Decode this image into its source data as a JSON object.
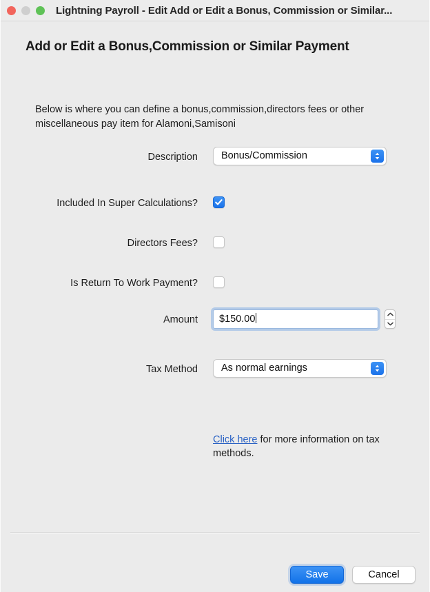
{
  "window": {
    "title": "Lightning Payroll - Edit Add or Edit a Bonus, Commission or Similar...",
    "traffic_lights": {
      "close": "close-button",
      "minimize": "minimize-button",
      "zoom": "zoom-button"
    }
  },
  "page": {
    "heading": "Add or Edit a Bonus,Commission or Similar Payment",
    "intro": "Below is where you can define a bonus,commission,directors fees or other miscellaneous pay item for Alamoni,Samisoni"
  },
  "form": {
    "description": {
      "label": "Description",
      "value": "Bonus/Commission"
    },
    "included_in_super": {
      "label": "Included In Super Calculations?",
      "checked": "true"
    },
    "directors_fees": {
      "label": "Directors Fees?",
      "checked": "false"
    },
    "return_to_work": {
      "label": "Is Return To Work Payment?",
      "checked": "false"
    },
    "amount": {
      "label": "Amount",
      "value": "$150.00"
    },
    "tax_method": {
      "label": "Tax Method",
      "value": "As normal earnings"
    }
  },
  "help": {
    "link_text": "Click here",
    "rest_text": " for more information on tax methods."
  },
  "footer": {
    "save_label": "Save",
    "cancel_label": "Cancel"
  },
  "colors": {
    "accent_blue": "#1b72ea",
    "link_blue": "#2a62c4",
    "window_bg": "#ebebeb",
    "titlebar_bg": "#ececec",
    "close_red": "#f2655c",
    "minimize_grey": "#cfcfcf",
    "zoom_green": "#5fc257"
  }
}
